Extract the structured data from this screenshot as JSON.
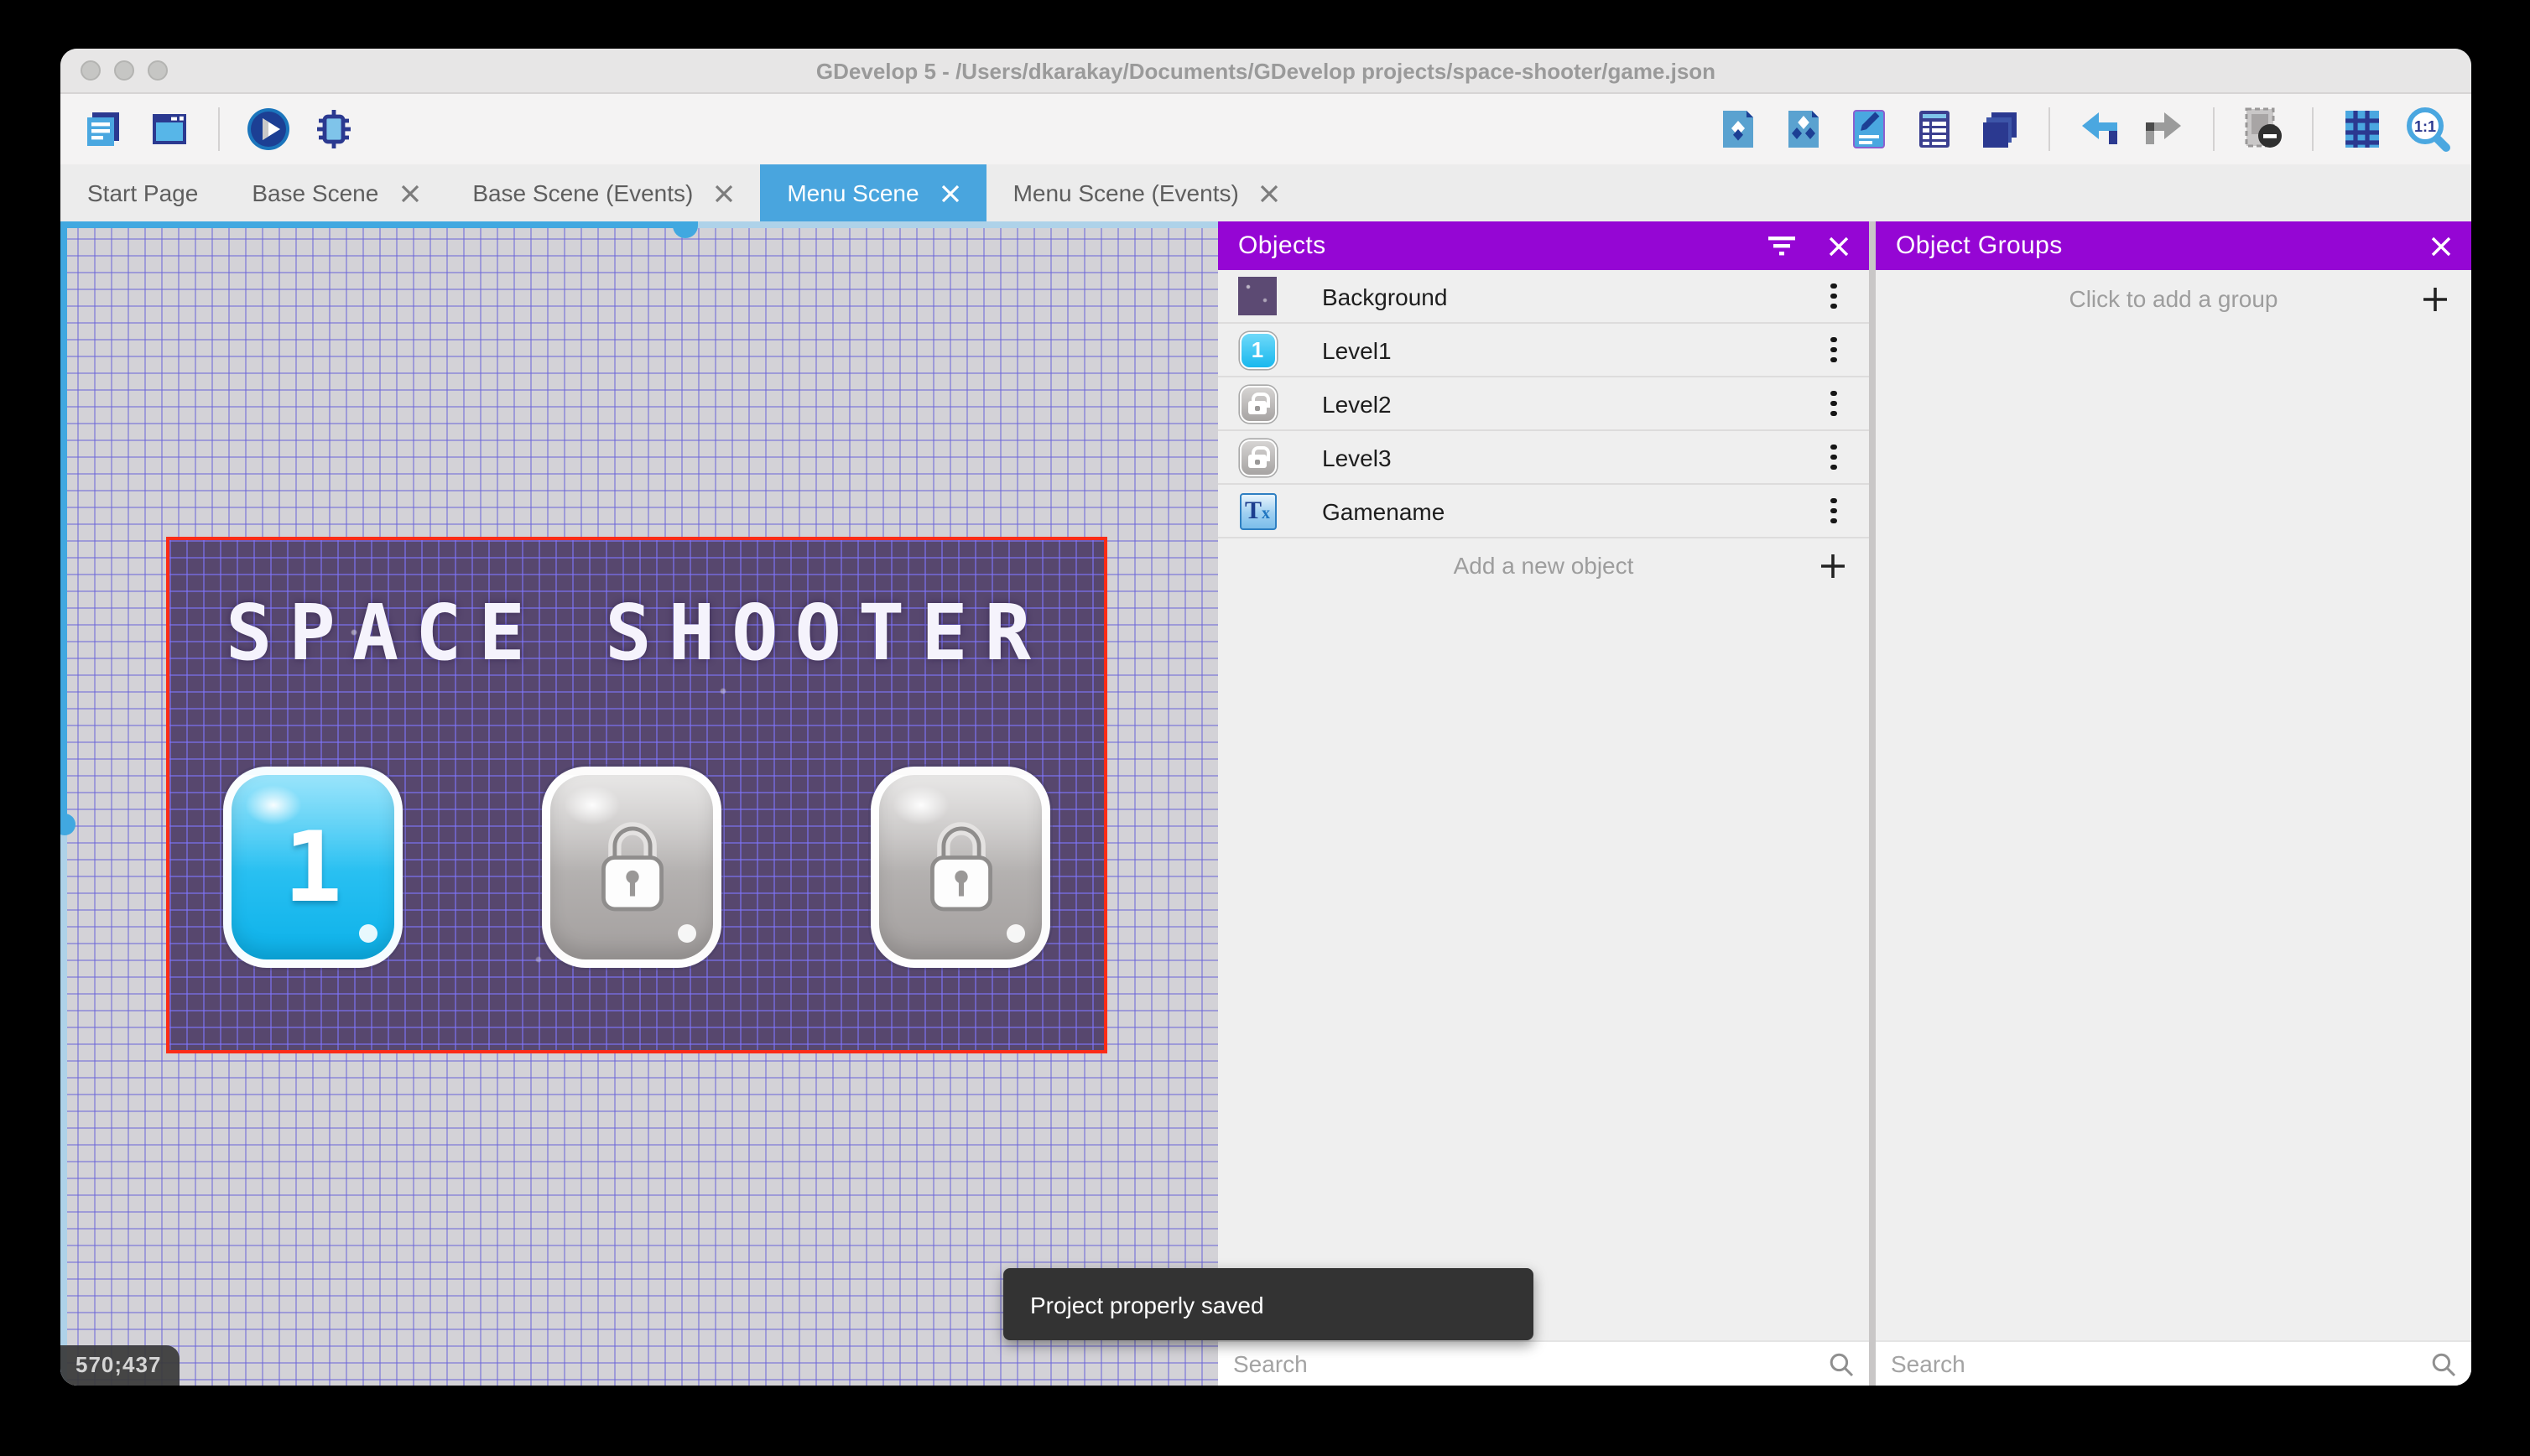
{
  "window": {
    "title": "GDevelop 5 - /Users/dkarakay/Documents/GDevelop projects/space-shooter/game.json"
  },
  "toolbar": {
    "left_icons": [
      "project-manager-icon",
      "scene-window-icon",
      "preview-play-icon",
      "debug-icon"
    ],
    "right_icons": [
      "objects-panel-icon",
      "object-groups-icon",
      "properties-icon",
      "instances-list-icon",
      "layers-icon",
      "undo-icon",
      "redo-icon",
      "window-mask-icon",
      "grid-icon",
      "zoom-original-icon"
    ],
    "zoom_icon_label": "1:1"
  },
  "tabs": [
    {
      "label": "Start Page",
      "active": false,
      "closable": false
    },
    {
      "label": "Base Scene",
      "active": false,
      "closable": true
    },
    {
      "label": "Base Scene (Events)",
      "active": false,
      "closable": true
    },
    {
      "label": "Menu Scene",
      "active": true,
      "closable": true
    },
    {
      "label": "Menu Scene (Events)",
      "active": false,
      "closable": true
    }
  ],
  "canvas": {
    "coordinates": "570;437",
    "scene": {
      "title": "SPACE SHOOTER",
      "level_buttons": [
        {
          "label": "1",
          "state": "unlocked"
        },
        {
          "label": "",
          "state": "locked"
        },
        {
          "label": "",
          "state": "locked"
        }
      ]
    }
  },
  "objects_panel": {
    "title": "Objects",
    "header_icons": [
      "filter-icon",
      "close-icon"
    ],
    "items": [
      {
        "name": "Background",
        "icon": "background-thumbnail",
        "thumb_text": ""
      },
      {
        "name": "Level1",
        "icon": "level-button-thumbnail",
        "thumb_text": "1"
      },
      {
        "name": "Level2",
        "icon": "locked-button-thumbnail",
        "thumb_text": ""
      },
      {
        "name": "Level3",
        "icon": "locked-button-thumbnail",
        "thumb_text": ""
      },
      {
        "name": "Gamename",
        "icon": "text-object-thumbnail",
        "thumb_text": "T",
        "thumb_sub": "x"
      }
    ],
    "add_label": "Add a new object",
    "search": {
      "placeholder": "Search",
      "value": ""
    }
  },
  "groups_panel": {
    "title": "Object Groups",
    "header_icons": [
      "close-icon"
    ],
    "empty_label": "Click to add a group",
    "search": {
      "placeholder": "Search",
      "value": ""
    }
  },
  "toast": {
    "message": "Project properly saved"
  },
  "colors": {
    "panel_header_purple": "#9506d4",
    "active_tab_blue": "#49a5de",
    "selection_red": "#fb2c17",
    "scene_purple": "#57476e",
    "scrollbar_blue": "#41a8e0",
    "toast_dark": "#333333"
  }
}
